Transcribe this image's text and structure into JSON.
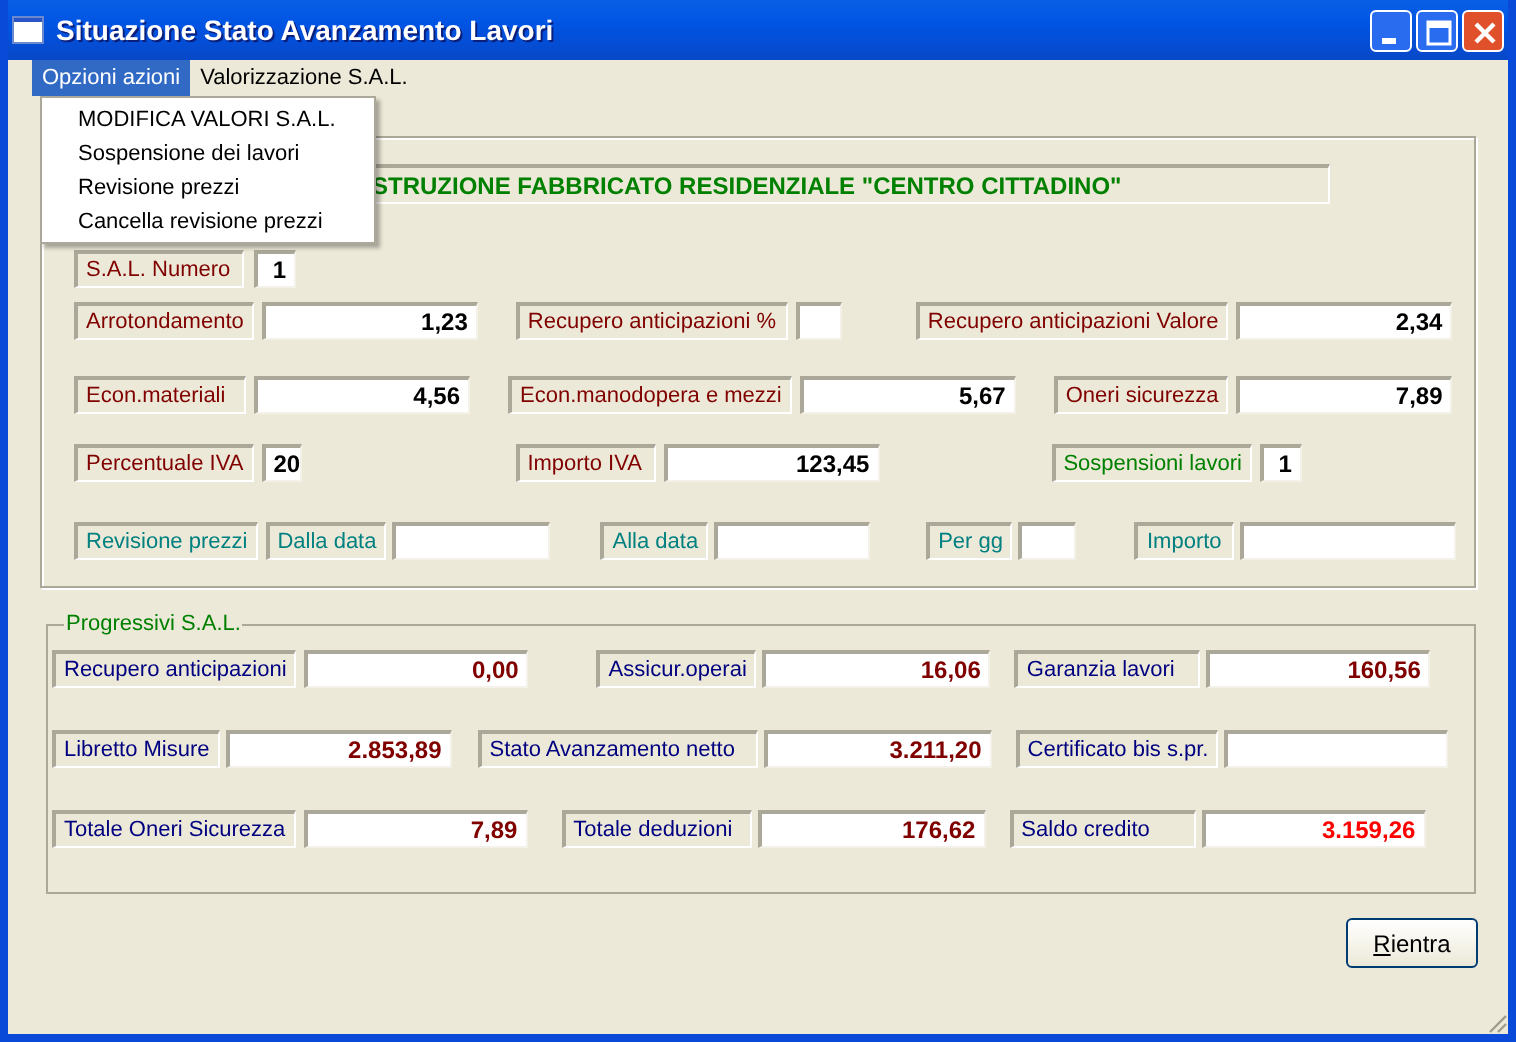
{
  "window": {
    "title": "Situazione Stato Avanzamento Lavori"
  },
  "menu_bar": [
    {
      "label": "Opzioni azioni",
      "selected": true
    },
    {
      "label": "Valorizzazione S.A.L.",
      "selected": false
    }
  ],
  "open_menu": {
    "items": [
      "MODIFICA VALORI S.A.L.",
      "Sospensione dei lavori",
      "Revisione prezzi",
      "Cancella revisione prezzi"
    ]
  },
  "project_title": "STRUZIONE FABBRICATO RESIDENZIALE \"CENTRO CITTADINO\"",
  "main_rows": [
    [
      {
        "kind": "label",
        "text": "S.A.L. Numero",
        "color": "#800000"
      },
      {
        "kind": "field",
        "value": "1",
        "color": "#000000"
      }
    ],
    [
      {
        "kind": "label",
        "text": "Arrotondamento",
        "color": "#800000"
      },
      {
        "kind": "field",
        "value": "1,23",
        "color": "#000000"
      },
      {
        "kind": "label",
        "text": "Recupero anticipazioni %",
        "color": "#800000"
      },
      {
        "kind": "field"
      },
      {
        "kind": "label",
        "text": "Recupero anticipazioni Valore",
        "color": "#800000"
      },
      {
        "kind": "field",
        "value": "2,34",
        "color": "#000000"
      }
    ],
    [
      {
        "kind": "label",
        "text": "Econ.materiali",
        "color": "#800000"
      },
      {
        "kind": "field",
        "value": "4,56",
        "color": "#000000"
      },
      {
        "kind": "label",
        "text": "Econ.manodopera e mezzi",
        "color": "#800000"
      },
      {
        "kind": "field",
        "value": "5,67",
        "color": "#000000"
      },
      {
        "kind": "label",
        "text": "Oneri sicurezza",
        "color": "#800000"
      },
      {
        "kind": "field",
        "value": "7,89",
        "color": "#000000"
      }
    ],
    [
      {
        "kind": "label",
        "text": "Percentuale IVA",
        "color": "#800000"
      },
      {
        "kind": "field",
        "value": "20",
        "color": "#000000"
      },
      {
        "kind": "label",
        "text": "Importo IVA",
        "color": "#800000"
      },
      {
        "kind": "field",
        "value": "123,45",
        "color": "#000000"
      },
      {
        "kind": "label",
        "text": "Sospensioni lavori",
        "color": "#008000"
      },
      {
        "kind": "field",
        "value": "1",
        "color": "#000000"
      }
    ],
    [
      {
        "kind": "label",
        "text": "Revisione prezzi",
        "color": "#008080"
      },
      {
        "kind": "label",
        "text": "Dalla data",
        "color": "#008080"
      },
      {
        "kind": "field"
      },
      {
        "kind": "label",
        "text": "Alla data",
        "color": "#008080"
      },
      {
        "kind": "field"
      },
      {
        "kind": "label",
        "text": "Per gg",
        "color": "#008080"
      },
      {
        "kind": "field"
      },
      {
        "kind": "label",
        "text": "Importo",
        "color": "#008080"
      },
      {
        "kind": "field"
      }
    ]
  ],
  "progressivi": {
    "title": "Progressivi S.A.L.",
    "rows": [
      [
        {
          "kind": "label",
          "text": "Recupero anticipazioni",
          "color": "#000080"
        },
        {
          "kind": "field",
          "value": "0,00",
          "color": "#800000"
        },
        {
          "kind": "label",
          "text": "Assicur.operai",
          "color": "#000080"
        },
        {
          "kind": "field",
          "value": "16,06",
          "color": "#800000"
        },
        {
          "kind": "label",
          "text": "Garanzia lavori",
          "color": "#000080"
        },
        {
          "kind": "field",
          "value": "160,56",
          "color": "#800000"
        }
      ],
      [
        {
          "kind": "label",
          "text": "Libretto Misure",
          "color": "#000080"
        },
        {
          "kind": "field",
          "value": "2.853,89",
          "color": "#800000"
        },
        {
          "kind": "label",
          "text": "Stato Avanzamento netto",
          "color": "#000080"
        },
        {
          "kind": "field",
          "value": "3.211,20",
          "color": "#800000"
        },
        {
          "kind": "label",
          "text": "Certificato bis s.pr.",
          "color": "#000080"
        },
        {
          "kind": "field"
        }
      ],
      [
        {
          "kind": "label",
          "text": "Totale Oneri Sicurezza",
          "color": "#000080"
        },
        {
          "kind": "field",
          "value": "7,89",
          "color": "#800000"
        },
        {
          "kind": "label",
          "text": "Totale deduzioni",
          "color": "#000080"
        },
        {
          "kind": "field",
          "value": "176,62",
          "color": "#800000"
        },
        {
          "kind": "label",
          "text": "Saldo credito",
          "color": "#000080"
        },
        {
          "kind": "field",
          "value": "3.159,26",
          "color": "#ff0000"
        }
      ]
    ]
  },
  "buttons": [
    {
      "mnemonic": "R",
      "rest": "ientra"
    }
  ]
}
